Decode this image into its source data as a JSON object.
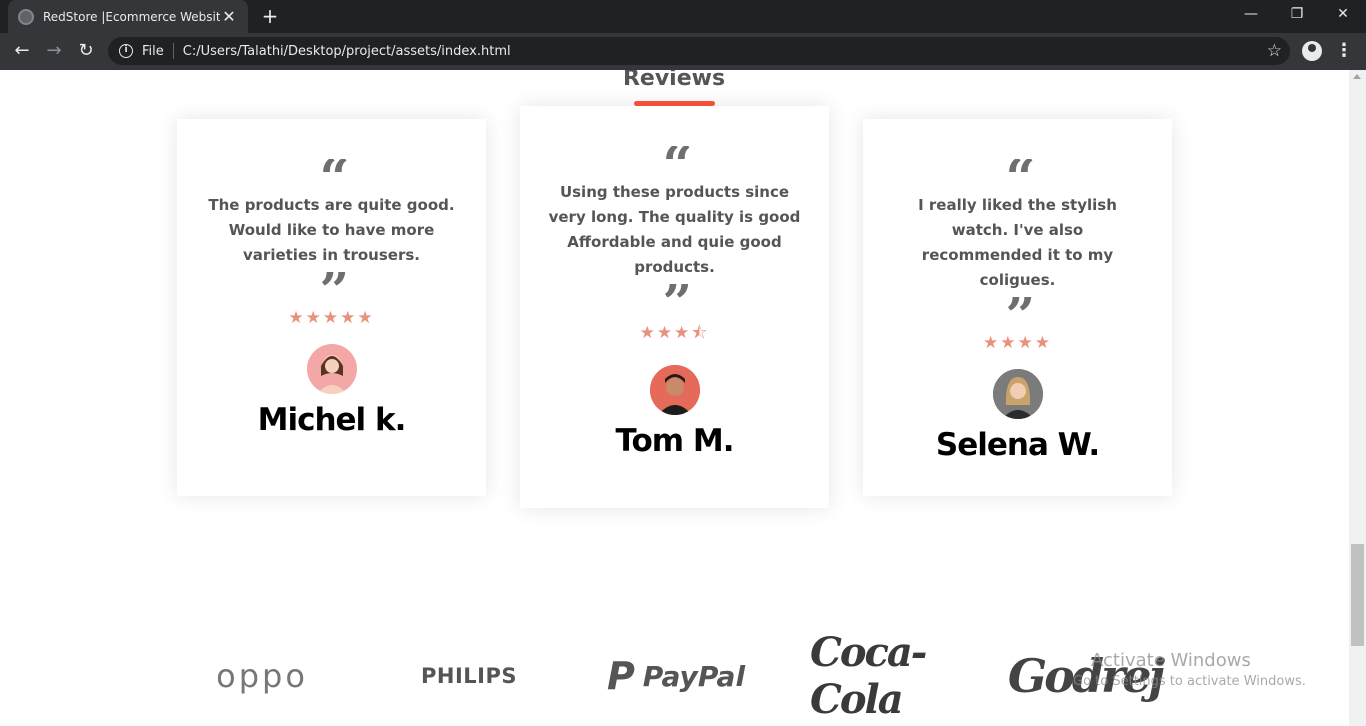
{
  "browser": {
    "tab_title": "RedStore |Ecommerce Website",
    "scheme_label": "File",
    "url": "C:/Users/Talathi/Desktop/project/assets/index.html"
  },
  "reviews": {
    "heading": "Reviews",
    "items": [
      {
        "text": "The products are quite good. Would like to have more varieties in trousers.",
        "rating": 5,
        "stars": "★★★★★",
        "name": "Michel k.",
        "avatar_color": "#f4a7a7"
      },
      {
        "text": "Using these products since very long. The quality is good Affordable and quie good products.",
        "rating": 3.5,
        "stars": "★★★⯪",
        "name": "Tom M.",
        "avatar_color": "#e0574d"
      },
      {
        "text": "I really liked the stylish watch. I've also recommended it to my coligues.",
        "rating": 4,
        "stars": "★★★★",
        "name": "Selena W.",
        "avatar_color": "#8a8a8a"
      }
    ]
  },
  "brands": [
    "oppo",
    "PHILIPS",
    "PayPal",
    "Coca-Cola",
    "Godrej"
  ],
  "watermark": {
    "title": "Activate Windows",
    "subtitle": "Go to Settings to activate Windows."
  },
  "colors": {
    "accent": "#ff523b",
    "star": "#e8927d"
  }
}
